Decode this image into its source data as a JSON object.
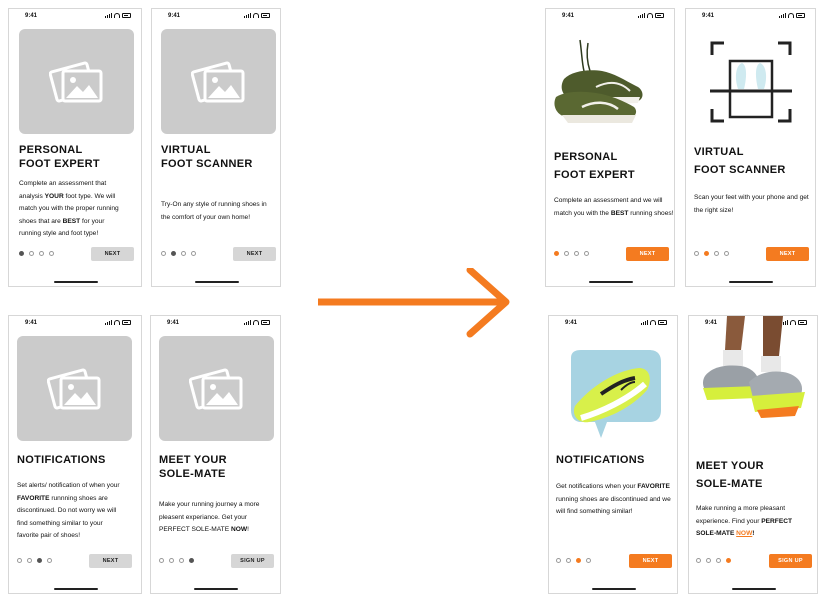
{
  "status_time": "9:41",
  "colors": {
    "accent": "#f47b20",
    "placeholder": "#cbcbcb",
    "button_gray": "#d6d6d6"
  },
  "icons": {
    "image_placeholder": "image-placeholder-icon",
    "arrow": "arrow-right-icon",
    "signal": "signal-icon",
    "wifi": "wifi-icon",
    "battery": "battery-icon"
  },
  "before": {
    "screen1": {
      "title_line1": "PERSONAL",
      "title_line2": "FOOT EXPERT",
      "desc": [
        "Complete an assessment that",
        "analysis ",
        "YOUR",
        " foot type. We will",
        "match you with the proper running",
        "shoes that are ",
        "BEST",
        " for your",
        "running style and foot type!"
      ],
      "button": "NEXT",
      "active_dot": 1
    },
    "screen2": {
      "title_line1": "VIRTUAL",
      "title_line2": "FOOT SCANNER",
      "desc": [
        "Try-On any style of running shoes in",
        "the comfort of your own home!"
      ],
      "button": "NEXT",
      "active_dot": 2
    },
    "screen3": {
      "title_line1": "NOTIFICATIONS",
      "desc": [
        "Set alerts/ notification of when your",
        "FAVORITE",
        " runnning shoes are",
        "discontinued. Do not worry we will",
        "find something similar to your",
        "favorite pair of shoes!"
      ],
      "button": "NEXT",
      "active_dot": 3
    },
    "screen4": {
      "title_line1": "MEET YOUR",
      "title_line2": "SOLE-MATE",
      "desc": [
        "Make your running journey a more",
        "pleasent experiance. Get your",
        "PERFECT SOLE-MATE ",
        "NOW",
        "!"
      ],
      "button": "SIGN UP",
      "active_dot": 4
    }
  },
  "after": {
    "screen1": {
      "title_line1": "PERSONAL",
      "title_line2": "FOOT EXPERT",
      "desc": [
        "Complete an assessment and we will",
        "match you with the ",
        "BEST",
        " running shoes!"
      ],
      "button": "NEXT",
      "active_dot": 1
    },
    "screen2": {
      "title_line1": "VIRTUAL",
      "title_line2": "FOOT SCANNER",
      "desc": [
        "Scan your feet with your phone and get",
        "the right size!"
      ],
      "button": "NEXT",
      "active_dot": 2
    },
    "screen3": {
      "title_line1": "NOTIFICATIONS",
      "desc": [
        "Get notifications when your ",
        "FAVORITE",
        "running shoes are discontinued and we",
        "will find something similar!"
      ],
      "button": "NEXT",
      "active_dot": 3
    },
    "screen4": {
      "title_line1": "MEET YOUR",
      "title_line2": "SOLE-MATE",
      "desc": [
        "Make running a more pleasant",
        "experience. Find your ",
        "PERFECT",
        "SOLE-MATE ",
        "NOW",
        "!"
      ],
      "button": "SIGN UP",
      "active_dot": 4
    }
  }
}
